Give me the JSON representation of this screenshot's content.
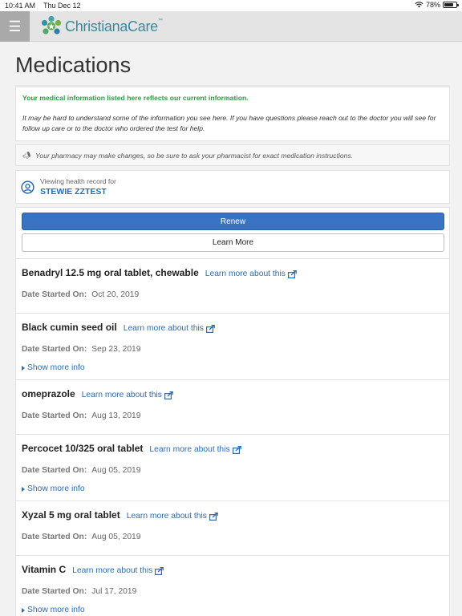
{
  "status_bar": {
    "time": "10:41 AM",
    "date": "Thu Dec 12",
    "battery": "78%",
    "battery_level": 0.78
  },
  "header": {
    "menu_icon": "hamburger-icon",
    "logo_text": "ChristianaCare",
    "logo_tm": "™"
  },
  "page": {
    "title": "Medications"
  },
  "info": {
    "notice": "Your medical information listed here reflects our current information.",
    "help": "It may be hard to understand some of the information you see here. If you have questions please reach out to the doctor you will see for follow up care or to the doctor who ordered the test for help."
  },
  "pharmacy": {
    "text": "Your pharmacy may make changes, so be sure to ask your pharmacist for exact medication instructions."
  },
  "patient": {
    "label": "Viewing health record for",
    "name": "STEWIE ZZTEST"
  },
  "actions": {
    "renew": "Renew",
    "learn_more": "Learn More"
  },
  "medications": [
    {
      "name": "Benadryl 12.5 mg oral tablet, chewable",
      "link": "Learn more about this",
      "date_label": "Date Started On:",
      "date": "Oct 20, 2019",
      "more": ""
    },
    {
      "name": "Black cumin seed oil",
      "link": "Learn more about this",
      "date_label": "Date Started On:",
      "date": "Sep 23, 2019",
      "more": "Show more info"
    },
    {
      "name": "omeprazole",
      "link": "Learn more about this",
      "date_label": "Date Started On:",
      "date": "Aug 13, 2019",
      "more": ""
    },
    {
      "name": "Percocet 10/325 oral tablet",
      "link": "Learn more about this",
      "date_label": "Date Started On:",
      "date": "Aug 05, 2019",
      "more": "Show more info"
    },
    {
      "name": "Xyzal 5 mg oral tablet",
      "link": "Learn more about this",
      "date_label": "Date Started On:",
      "date": "Aug 05, 2019",
      "more": ""
    },
    {
      "name": "Vitamin C",
      "link": "Learn more about this",
      "date_label": "Date Started On:",
      "date": "Jul 17, 2019",
      "more": "Show more info"
    }
  ],
  "colors": {
    "accent": "#3873c4",
    "link": "#2b6cb0",
    "notice_green": "#2e9a3e",
    "brand_teal": "#3a8a9c"
  }
}
